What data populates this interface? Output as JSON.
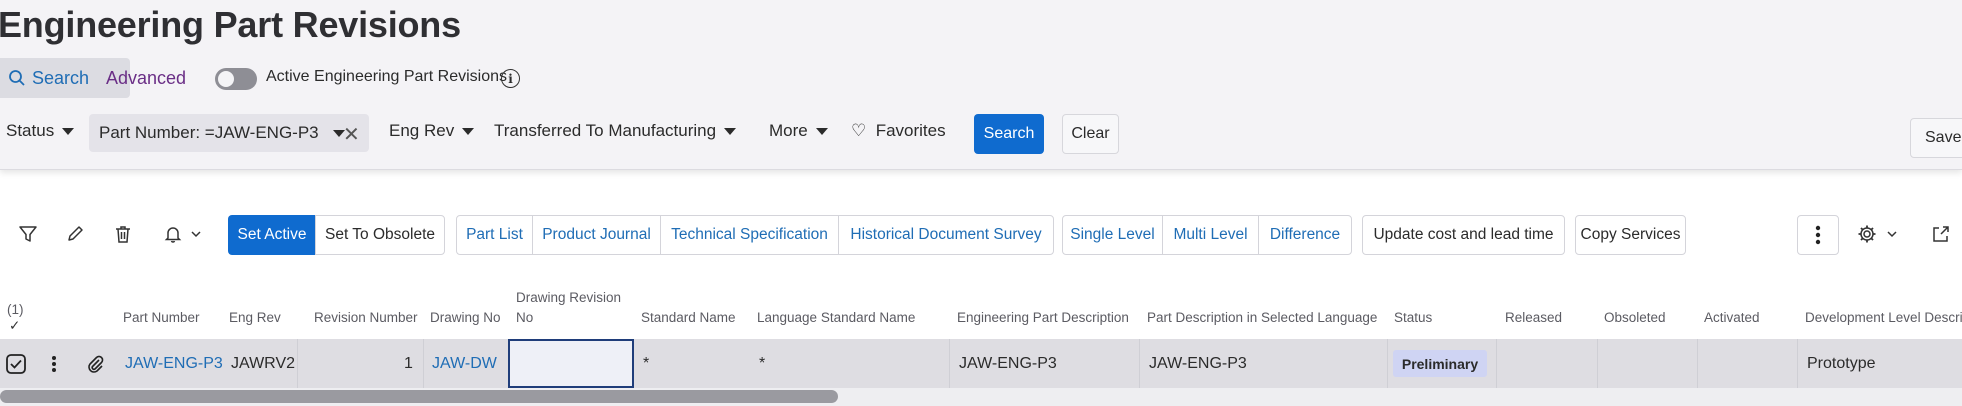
{
  "page": {
    "title": "Engineering Part Revisions"
  },
  "search_tabs": {
    "search": "Search",
    "advanced": "Advanced"
  },
  "active_toggle": {
    "label": "Active Engineering Part Revisions",
    "on": false
  },
  "filters": {
    "status": "Status",
    "part_number_chip": "Part Number: =JAW-ENG-P3",
    "eng_rev": "Eng Rev",
    "transferred": "Transferred To Manufacturing",
    "more": "More",
    "favorites": "Favorites",
    "search_button": "Search",
    "clear_button": "Clear",
    "saved_button": "Saved"
  },
  "toolbar": {
    "set_active": "Set Active",
    "set_to_obsolete": "Set To Obsolete",
    "part_list": "Part List",
    "product_journal": "Product Journal",
    "technical_specification": "Technical Specification",
    "historical_document_survey": "Historical Document Survey",
    "single_level": "Single Level",
    "multi_level": "Multi Level",
    "difference": "Difference",
    "update_cost": "Update cost and lead time",
    "copy_services": "Copy Services"
  },
  "table": {
    "selection_count": "(1)",
    "columns": {
      "part_number": "Part Number",
      "eng_rev": "Eng Rev",
      "revision_number": "Revision Number",
      "drawing_no": "Drawing No",
      "drawing_revision_no_1": "Drawing Revision",
      "drawing_revision_no_2": "No",
      "standard_name": "Standard Name",
      "language_standard_name": "Language Standard Name",
      "engineering_part_description": "Engineering Part Description",
      "part_description_selected_language": "Part Description in Selected Language",
      "status": "Status",
      "released": "Released",
      "obsoleted": "Obsoleted",
      "activated": "Activated",
      "development_level": "Development Level Descrip"
    },
    "row": {
      "part_number": "JAW-ENG-P3",
      "eng_rev": "JAWRV2",
      "revision_number": "1",
      "drawing_no": "JAW-DW",
      "drawing_revision_no": "",
      "standard_name": "*",
      "language_standard_name": "*",
      "engineering_part_description": "JAW-ENG-P3",
      "part_description_selected_language": "JAW-ENG-P3",
      "status": "Preliminary",
      "released": "",
      "obsoleted": "",
      "activated": "",
      "development_level": "Prototype"
    }
  },
  "colors": {
    "primary": "#0f6bcf",
    "link": "#1f6db5",
    "advanced": "#6a2e86",
    "badge": "#cfd4f3"
  }
}
